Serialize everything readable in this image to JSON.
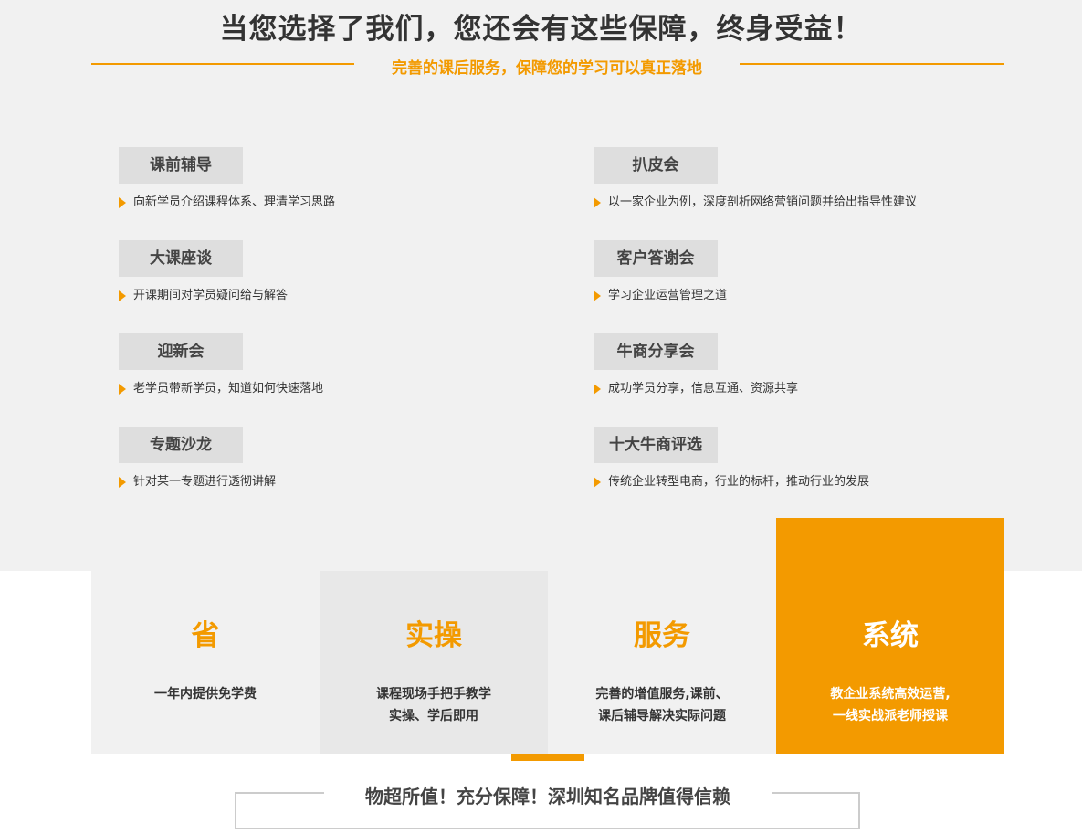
{
  "header": {
    "title": "当您选择了我们，您还会有这些保障，终身受益！",
    "subtitle": "完善的课后服务，保障您的学习可以真正落地"
  },
  "services": {
    "left": [
      {
        "tag": "课前辅导",
        "desc": "向新学员介绍课程体系、理清学习思路"
      },
      {
        "tag": "大课座谈",
        "desc": "开课期间对学员疑问给与解答"
      },
      {
        "tag": "迎新会",
        "desc": "老学员带新学员，知道如何快速落地"
      },
      {
        "tag": "专题沙龙",
        "desc": "针对某一专题进行透彻讲解"
      }
    ],
    "right": [
      {
        "tag": "扒皮会",
        "desc": "以一家企业为例，深度剖析网络营销问题并给出指导性建议"
      },
      {
        "tag": "客户答谢会",
        "desc": "学习企业运营管理之道"
      },
      {
        "tag": "牛商分享会",
        "desc": "成功学员分享，信息互通、资源共享"
      },
      {
        "tag": "十大牛商评选",
        "desc": "传统企业转型电商，行业的标杆，推动行业的发展"
      }
    ]
  },
  "features": [
    {
      "title": "省",
      "line1": "一年内提供免学费",
      "line2": "",
      "bg": "#f1f1f1"
    },
    {
      "title": "实操",
      "line1": "课程现场手把手教学",
      "line2": "实操、学后即用",
      "bg": "#e8e8e8"
    },
    {
      "title": "服务",
      "line1": "完善的增值服务,课前、",
      "line2": "课后辅导解决实际问题",
      "bg": "#f1f1f1"
    },
    {
      "title": "系统",
      "line1": "教企业系统高效运营,",
      "line2": "一线实战派老师授课",
      "bg": "#f39a00"
    }
  ],
  "footer": {
    "slogan": "物超所值！充分保障！深圳知名品牌值得信赖"
  },
  "colors": {
    "accent": "#f39a00",
    "panel": "#f1f1f1",
    "tag_bg": "#dedede"
  },
  "icons": {
    "bullet": "arrow-right-icon"
  }
}
